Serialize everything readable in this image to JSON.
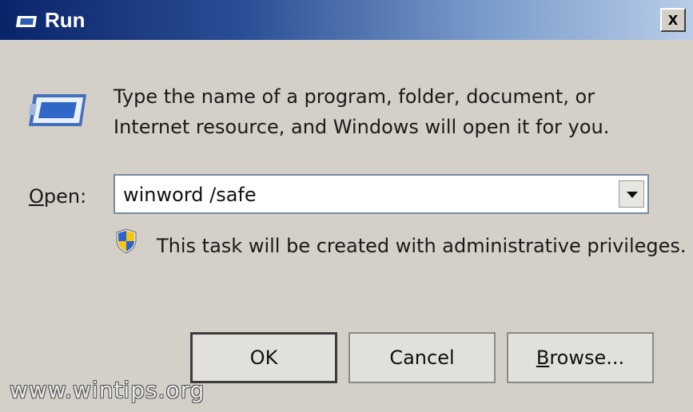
{
  "window": {
    "title": "Run"
  },
  "titlebar": {
    "close_label": "x"
  },
  "content": {
    "description": "Type the name of a program, folder, document, or Internet resource, and Windows will open it for you.",
    "open_label_accel": "O",
    "open_label_rest": "pen:",
    "open_value": "winword /safe",
    "admin_notice": "This task will be created with administrative privileges."
  },
  "buttons": {
    "ok": "OK",
    "cancel": "Cancel",
    "browse_accel": "B",
    "browse_rest": "rowse..."
  },
  "watermark": "www.wintips.org",
  "icons": {
    "title": "run-icon",
    "main": "run-icon",
    "shield": "uac-shield-icon",
    "dropdown": "chevron-down-icon"
  }
}
